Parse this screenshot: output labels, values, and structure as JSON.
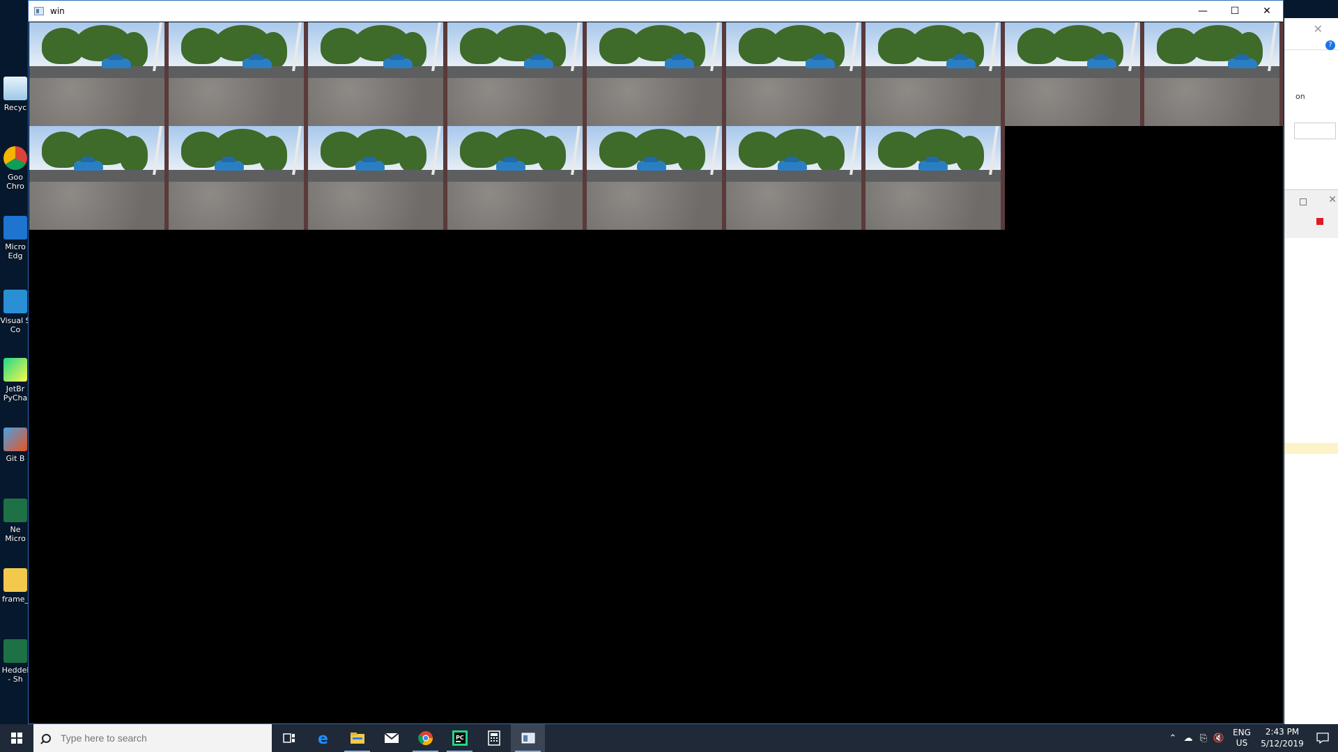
{
  "desktop_icons": [
    {
      "label": "Recyc",
      "icon": "recycle-bin-icon"
    },
    {
      "label": "Goo\nChro",
      "icon": "chrome-icon"
    },
    {
      "label": "Micro\nEdg",
      "icon": "edge-icon"
    },
    {
      "label": "Visual S\nCo",
      "icon": "vscode-icon"
    },
    {
      "label": "JetBr\nPyCha",
      "icon": "pycharm-icon"
    },
    {
      "label": "Git B",
      "icon": "git-bash-icon"
    },
    {
      "label": "Ne\nMicro",
      "icon": "excel-icon"
    },
    {
      "label": "frame_",
      "icon": "folder-icon"
    },
    {
      "label": "Heddel\n- Sh",
      "icon": "excel-icon"
    }
  ],
  "window": {
    "title": "win",
    "minimize": "—",
    "maximize": "☐",
    "close": "✕",
    "frame_count": 16
  },
  "background_window": {
    "text": "on"
  },
  "taskbar": {
    "search_placeholder": "Type here to search",
    "apps": [
      "task-view-icon",
      "edge-icon",
      "file-explorer-icon",
      "mail-icon",
      "chrome-icon",
      "pycharm-icon",
      "calculator-icon",
      "window-app-icon"
    ],
    "tray": {
      "lang_top": "ENG",
      "lang_bottom": "US",
      "time": "2:43 PM",
      "date": "5/12/2019"
    }
  },
  "colors": {
    "taskbar": "#1f2937",
    "window_border": "#2d6db5",
    "car": "#2a7fc4"
  }
}
